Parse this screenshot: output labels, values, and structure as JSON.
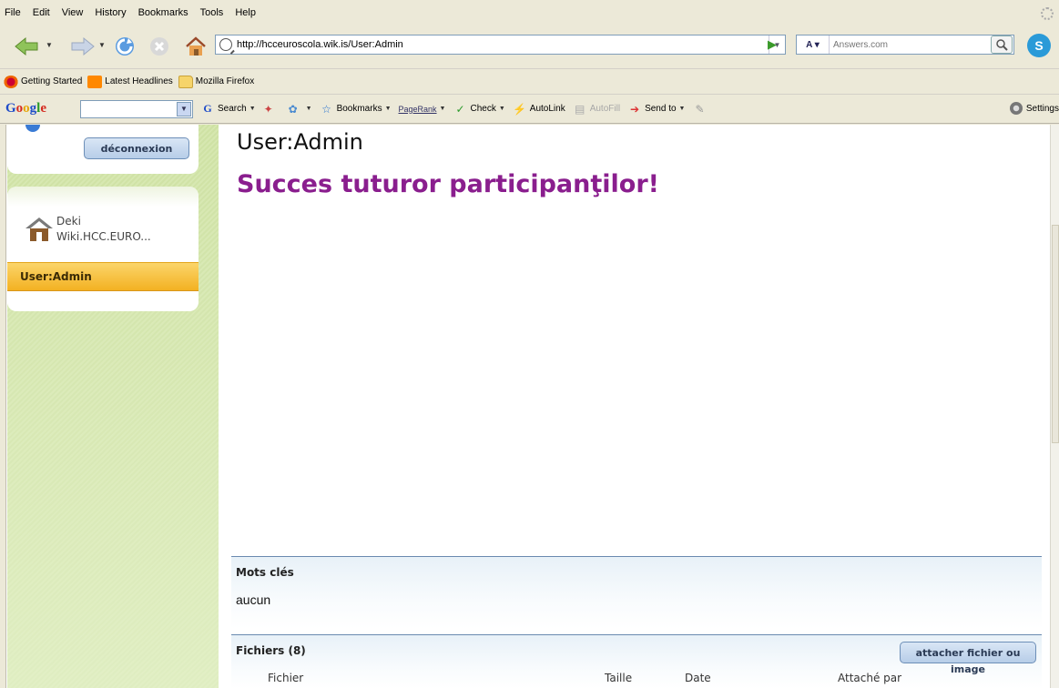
{
  "menu": [
    "File",
    "Edit",
    "View",
    "History",
    "Bookmarks",
    "Tools",
    "Help"
  ],
  "navigation": {
    "url": "http://hcceuroscola.wik.is/User:Admin",
    "search_placeholder": "Answers.com"
  },
  "bookmarks": [
    "Getting Started",
    "Latest Headlines",
    "Mozilla Firefox"
  ],
  "google_toolbar": {
    "logo": "Google",
    "search_label": "Search",
    "bookmarks_label": "Bookmarks",
    "pagerank_label": "PageRank",
    "check_label": "Check",
    "autolink_label": "AutoLink",
    "autofill_label": "AutoFill",
    "sendto_label": "Send to",
    "settings_label": "Settings"
  },
  "sidebar": {
    "disconnect_label": "déconnexion",
    "home_line1": "Deki",
    "home_line2": "Wiki.HCC.EURO...",
    "active_page": "User:Admin"
  },
  "page": {
    "title": "User:Admin",
    "heading": "Succes tuturor participanţilor!"
  },
  "tags": {
    "title": "Mots clés",
    "value": "aucun"
  },
  "files": {
    "title": "Fichiers (8)",
    "attach_label": "attacher fichier ou",
    "attach_label2": "image",
    "columns": [
      "Fichier",
      "Taille",
      "Date",
      "Attaché par"
    ]
  }
}
